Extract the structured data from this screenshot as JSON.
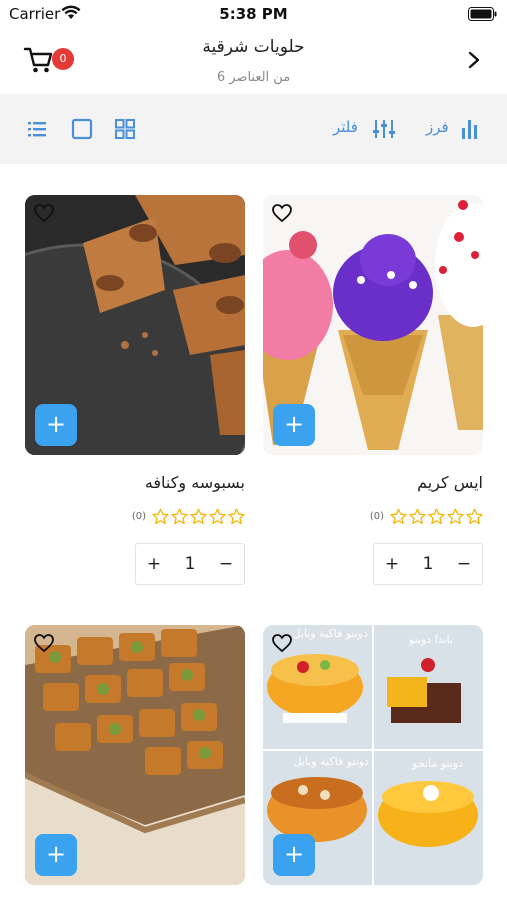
{
  "status_bar": {
    "carrier": "Carrier",
    "time": "5:38 PM"
  },
  "header": {
    "title": "حلويات شرقية",
    "subtitle": "6 من العناصر",
    "cart_count": "0"
  },
  "toolbar": {
    "sort_label": "فرز",
    "filter_label": "فلتر"
  },
  "colors": {
    "accent": "#3aa2ef",
    "badge": "#e53935",
    "star": "#f4b400",
    "toolbar_icon": "#4a90d9"
  },
  "products": [
    {
      "name": "ايس كريم",
      "rating_count": "(0)",
      "quantity": "1",
      "image": "ice-cream"
    },
    {
      "name": "بسبوسه وكنافه",
      "rating_count": "(0)",
      "quantity": "1",
      "image": "basbousa"
    },
    {
      "image": "cakes"
    },
    {
      "image": "baklava"
    }
  ],
  "cake_labels": [
    "دوبتو فاكية ونابل",
    "باندا دوبتو",
    "دونتو فاكية وبايل",
    "دوبتو مانجو"
  ]
}
